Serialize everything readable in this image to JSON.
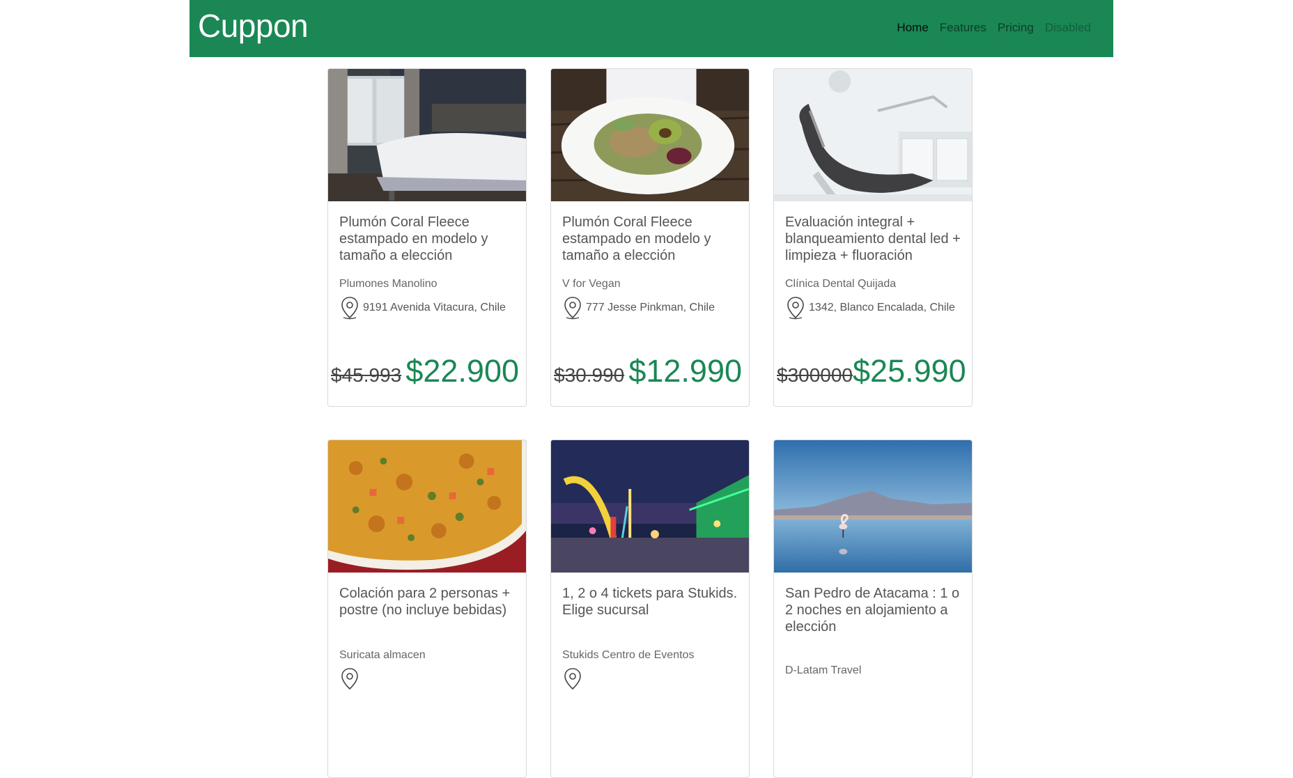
{
  "header": {
    "brand": "Cuppon",
    "nav": [
      {
        "label": "Home",
        "state": "active"
      },
      {
        "label": "Features",
        "state": "normal"
      },
      {
        "label": "Pricing",
        "state": "normal"
      },
      {
        "label": "Disabled",
        "state": "disabled"
      }
    ]
  },
  "colors": {
    "brand": "#1a8755",
    "navbar": "#1a8755"
  },
  "cards": [
    {
      "image": "bedroom-photo",
      "title": "Plumón Coral Fleece estampado en modelo y tamaño a elección",
      "vendor": "Plumones Manolino",
      "address": "9191 Avenida Vitacura, Chile",
      "old_price": "$45.993",
      "new_price": "$22.900"
    },
    {
      "image": "vegan-salad-photo",
      "title": "Plumón Coral Fleece estampado en modelo y tamaño a elección",
      "vendor": "V for Vegan",
      "address": "777 Jesse Pinkman, Chile",
      "old_price": "$30.990",
      "new_price": "$12.990"
    },
    {
      "image": "dental-chair-photo",
      "title": "Evaluación integral + blanqueamiento dental led + limpieza + fluoración",
      "vendor": "Clínica Dental Quijada",
      "address": "1342, Blanco Encalada, Chile",
      "old_price": "$300000",
      "new_price": "$25.990"
    },
    {
      "image": "food-dish-photo",
      "title": "Colación para 2 personas + postre (no incluye bebidas)",
      "vendor": "Suricata almacen",
      "address": "",
      "old_price": "",
      "new_price": ""
    },
    {
      "image": "fair-night-photo",
      "title": "1, 2 o 4 tickets para Stukids. Elige sucursal",
      "vendor": "Stukids Centro de Eventos",
      "address": "",
      "old_price": "",
      "new_price": ""
    },
    {
      "image": "atacama-flamingo-photo",
      "title": "San Pedro de Atacama : 1 o 2 noches en alojamiento a elección",
      "vendor": "D-Latam Travel",
      "address": "",
      "old_price": "",
      "new_price": ""
    }
  ]
}
